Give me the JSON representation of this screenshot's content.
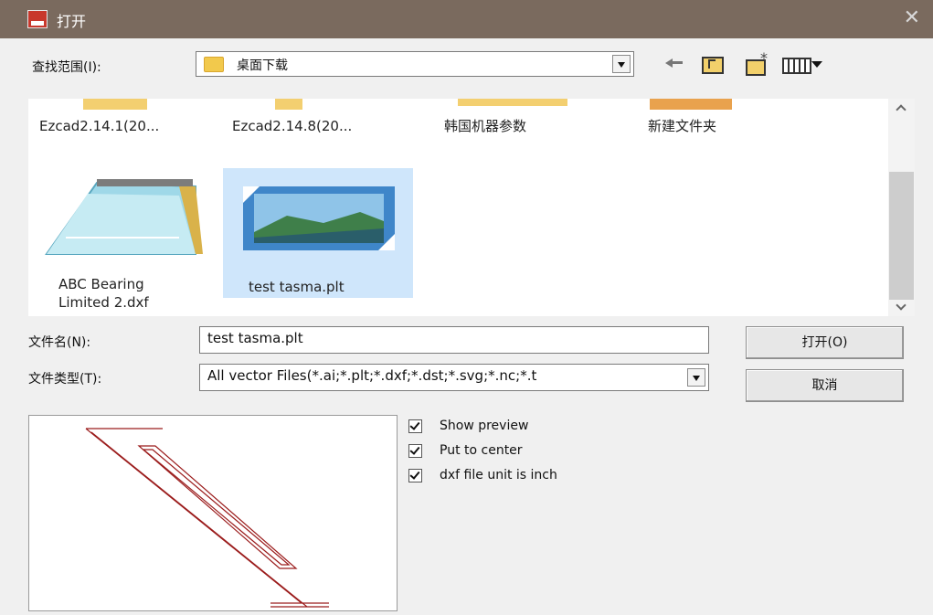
{
  "window": {
    "title": "打开",
    "close_symbol": "✕"
  },
  "lookin": {
    "label": "查找范围(I):",
    "value": "桌面下载"
  },
  "files": {
    "row1": [
      "Ezcad2.14.1(20...",
      "Ezcad2.14.8(20...",
      "韩国机器参数",
      "新建文件夹"
    ],
    "row2": [
      {
        "line1": "ABC Bearing",
        "line2": "Limited 2.dxf",
        "selected": false
      },
      {
        "line1": "test tasma.plt",
        "line2": "",
        "selected": true
      }
    ]
  },
  "filename": {
    "label": "文件名(N):",
    "value": "test tasma.plt"
  },
  "filetype": {
    "label": "文件类型(T):",
    "value": "All vector Files(*.ai;*.plt;*.dxf;*.dst;*.svg;*.nc;*.t"
  },
  "buttons": {
    "open": "打开(O)",
    "cancel": "取消"
  },
  "options": [
    {
      "label": "Show preview",
      "checked": true
    },
    {
      "label": "Put to center",
      "checked": true
    },
    {
      "label": "dxf file unit is inch",
      "checked": true
    }
  ],
  "icons": {
    "app": "app-icon",
    "close": "close-icon",
    "folder": "folder-icon",
    "back": "back-arrow-icon",
    "up": "up-folder-icon",
    "new_folder": "new-folder-icon",
    "view": "view-menu-icon",
    "notepad": "notepad-file-icon",
    "image": "image-file-icon"
  },
  "colors": {
    "titlebar": "#7a6a5e",
    "selection": "#cfe6fb",
    "preview_stroke": "#9b1c1c"
  }
}
